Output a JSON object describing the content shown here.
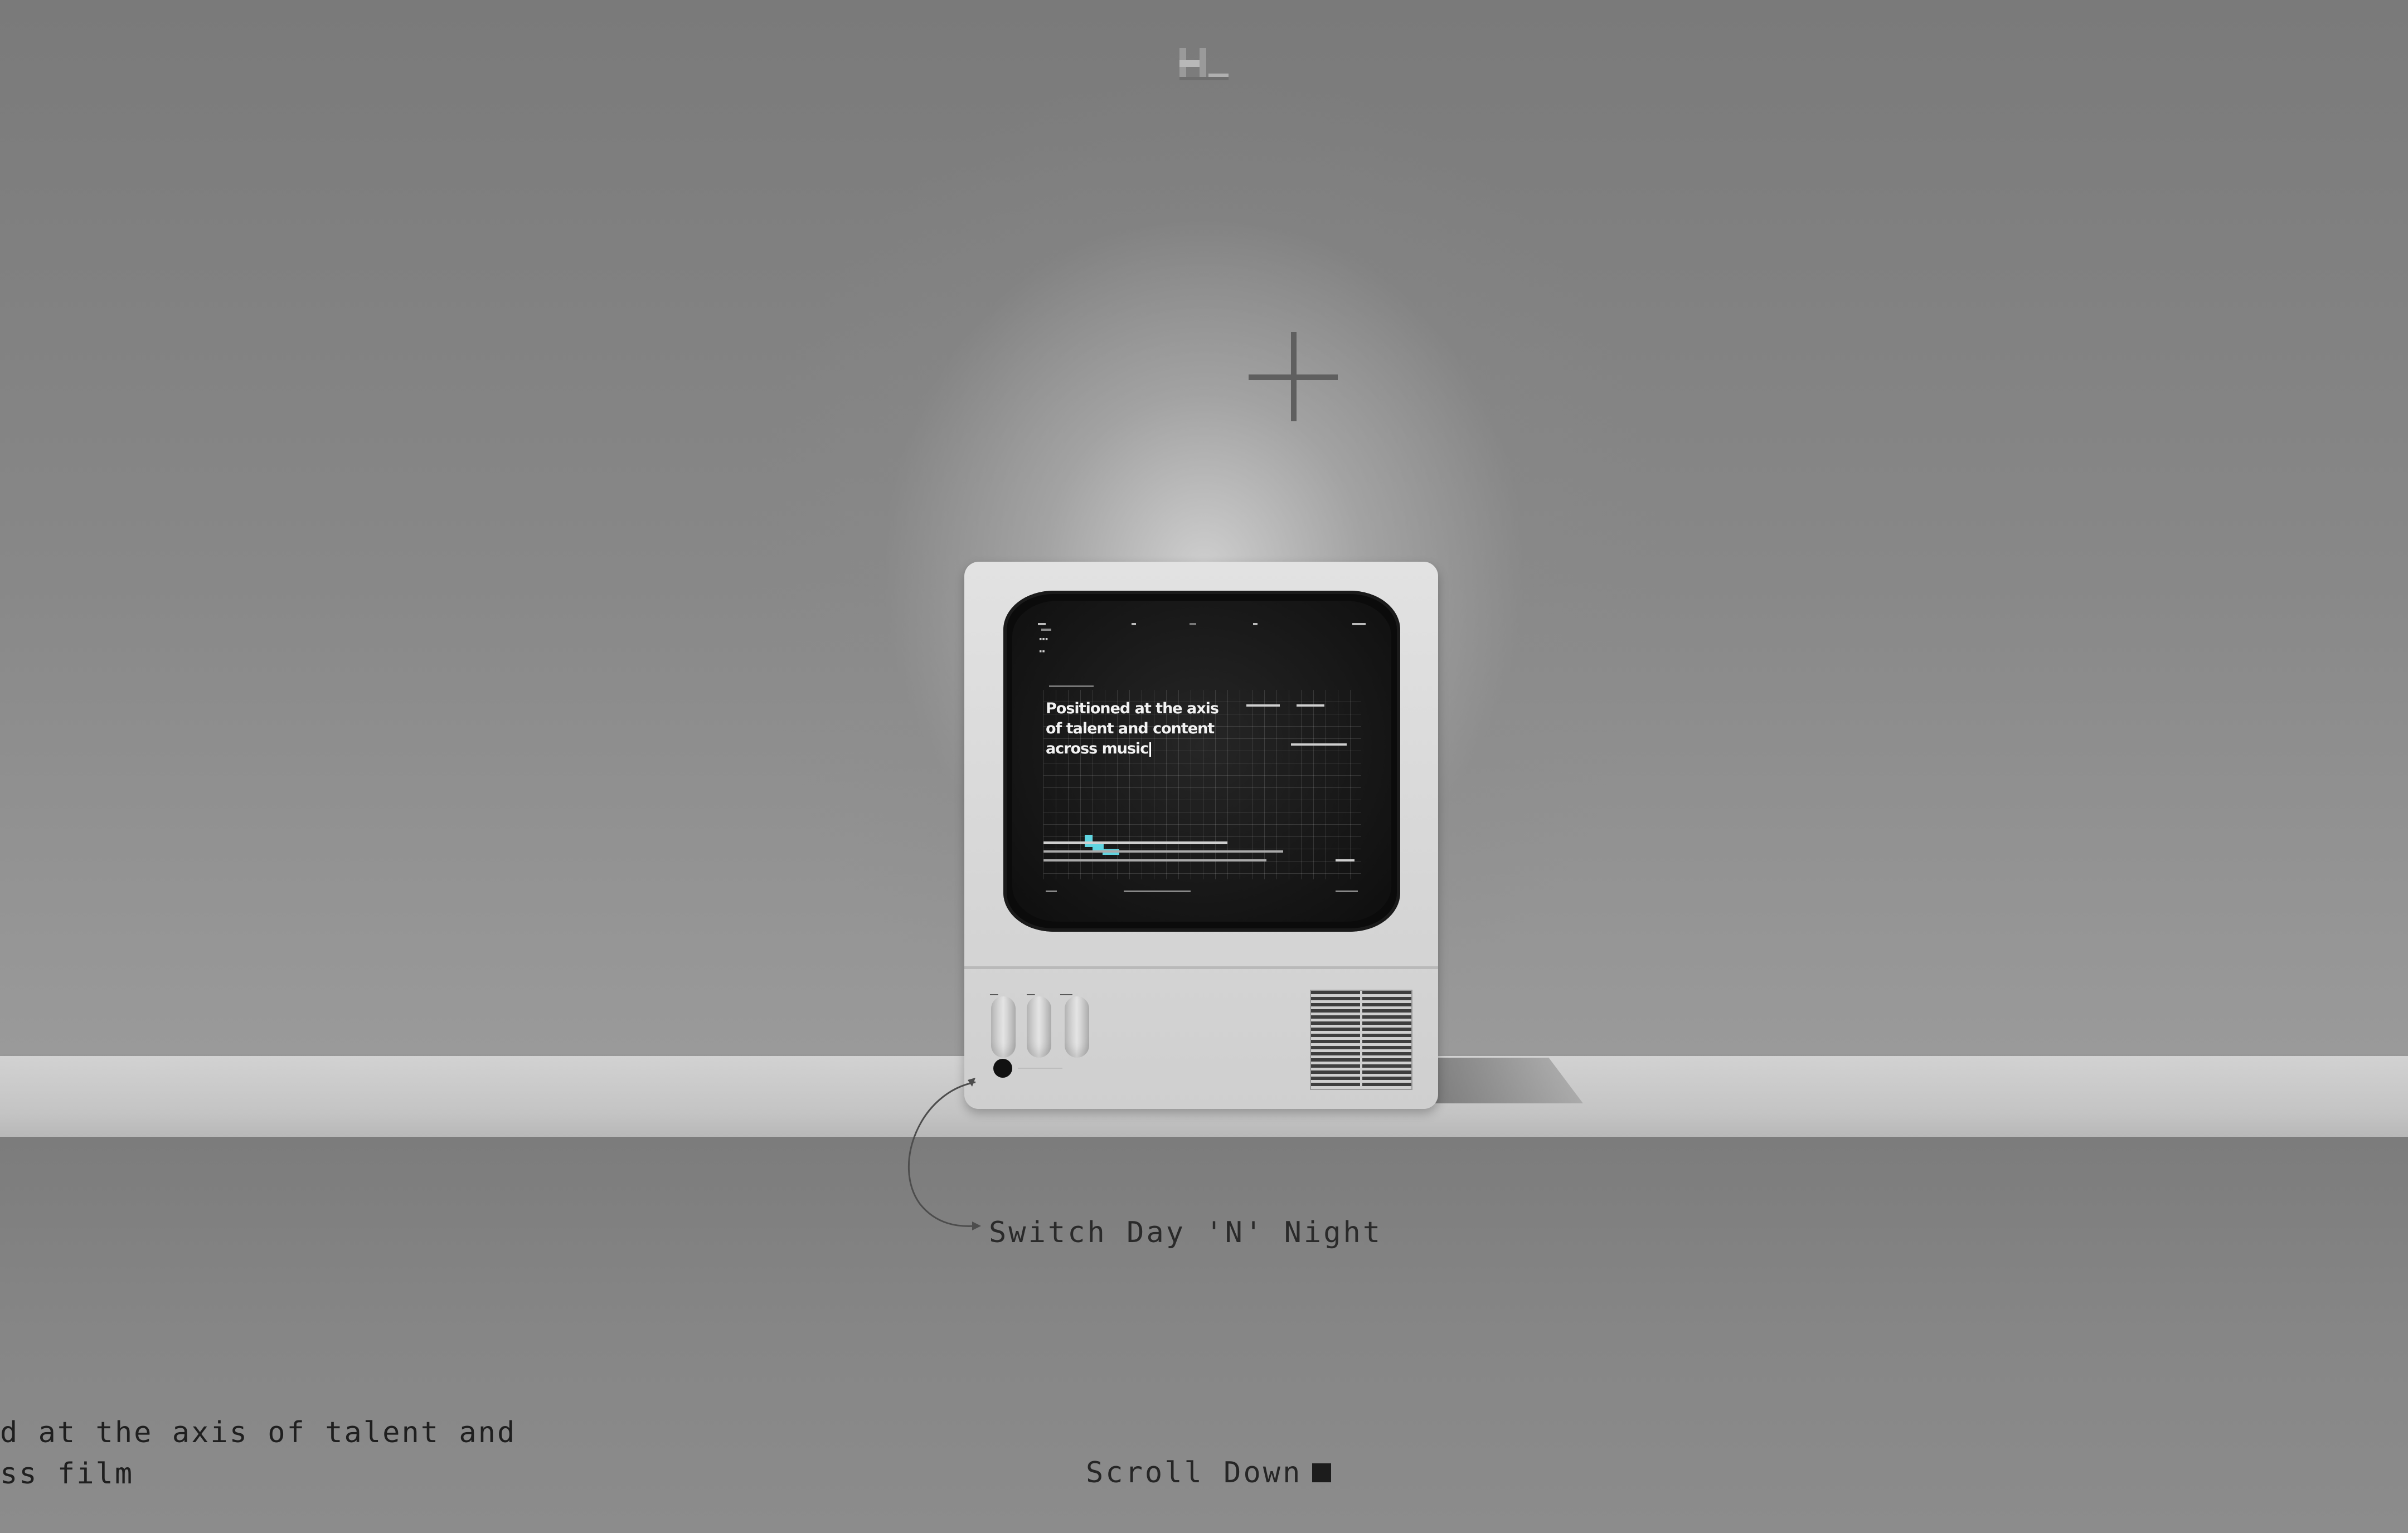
{
  "header": {
    "logo_icon": "hl-logo-icon"
  },
  "tv_screen": {
    "headline_lines": [
      "Positioned at the axis",
      "of talent and content",
      "across music"
    ]
  },
  "annotation": {
    "switch_label": "Switch Day 'N' Night"
  },
  "footer": {
    "marquee_lines": [
      "d at the axis of talent and",
      "ss film"
    ],
    "scroll_down_label": "Scroll Down"
  },
  "colors": {
    "wall": "#7e7e7e",
    "shelf": "#cccccc",
    "screen_bg": "#151515",
    "accent_cyan": "#5fd4e0",
    "text": "#262626"
  }
}
